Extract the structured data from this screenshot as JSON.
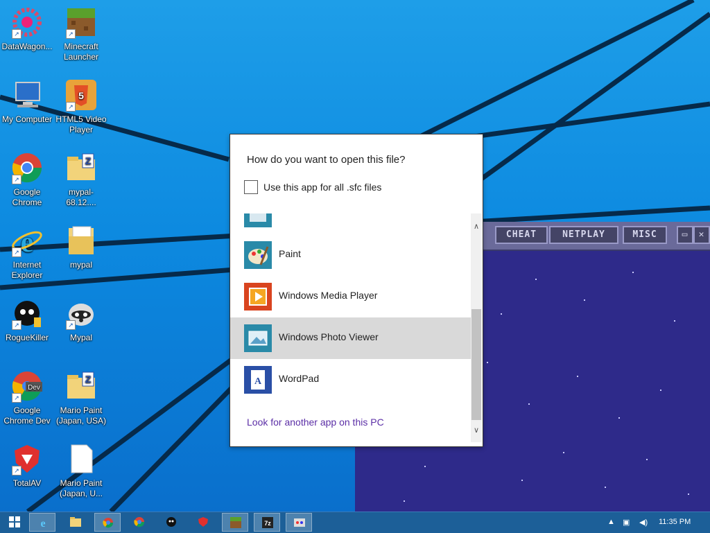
{
  "desktop": {
    "icons": [
      {
        "label": "DataWagon...",
        "icon": "datawagon-icon"
      },
      {
        "label": "Minecraft Launcher",
        "icon": "minecraft-icon"
      },
      {
        "label": "My Computer",
        "icon": "computer-icon"
      },
      {
        "label": "HTML5 Video Player",
        "icon": "html5-icon"
      },
      {
        "label": "Google Chrome",
        "icon": "chrome-icon"
      },
      {
        "label": "mypal-68.12....",
        "icon": "zip-folder-icon"
      },
      {
        "label": "Internet Explorer",
        "icon": "ie-icon"
      },
      {
        "label": "mypal",
        "icon": "folder-icon"
      },
      {
        "label": "RogueKiller",
        "icon": "roguekiller-icon"
      },
      {
        "label": "Mypal",
        "icon": "mypal-icon"
      },
      {
        "label": "Google Chrome Dev",
        "icon": "chrome-dev-icon"
      },
      {
        "label": "Mario Paint (Japan, USA)",
        "icon": "zip-folder-icon"
      },
      {
        "label": "TotalAV",
        "icon": "totalav-icon"
      },
      {
        "label": "Mario Paint (Japan, U...",
        "icon": "file-icon"
      }
    ]
  },
  "emulator": {
    "buttons": [
      "CHEAT",
      "NETPLAY",
      "MISC"
    ]
  },
  "dialog": {
    "title": "How do you want to open this file?",
    "checkbox_label": "Use this app for all .sfc files",
    "checkbox_checked": false,
    "apps": [
      {
        "label": "",
        "icon": "partial-app-icon",
        "selected": false
      },
      {
        "label": "Paint",
        "icon": "paint-icon",
        "selected": false
      },
      {
        "label": "Windows Media Player",
        "icon": "media-player-icon",
        "selected": false
      },
      {
        "label": "Windows Photo Viewer",
        "icon": "photo-viewer-icon",
        "selected": true
      },
      {
        "label": "WordPad",
        "icon": "wordpad-icon",
        "selected": false
      }
    ],
    "more_link": "Look for another app on this PC"
  },
  "taskbar": {
    "apps": [
      "start-icon",
      "ie-icon",
      "file-explorer-icon",
      "chrome-icon",
      "chrome-dev-icon",
      "roguekiller-icon",
      "totalav-icon",
      "minecraft-icon",
      "7zip-icon",
      "emulator-icon"
    ],
    "clock": "11:35 PM",
    "colors": {
      "taskbar": "#1c5f98",
      "accent": "#0d8ae0"
    }
  }
}
